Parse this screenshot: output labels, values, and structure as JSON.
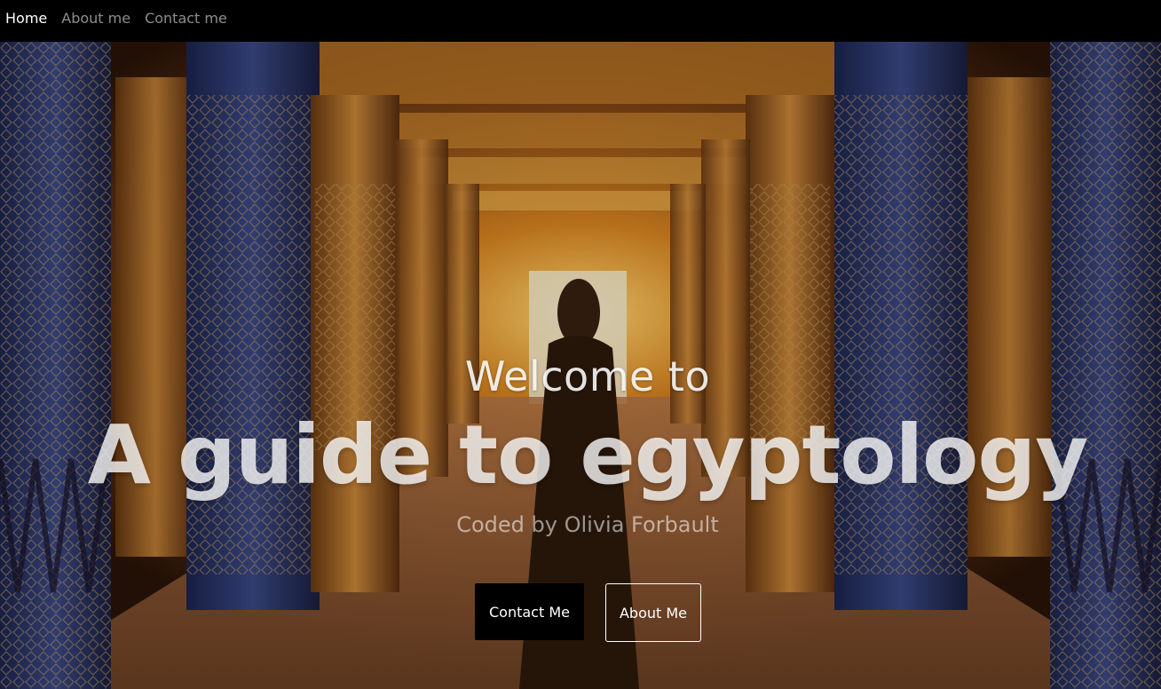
{
  "nav": {
    "items": [
      {
        "label": "Home",
        "active": true
      },
      {
        "label": "About me",
        "active": false
      },
      {
        "label": "Contact me",
        "active": false
      }
    ]
  },
  "hero": {
    "welcome": "Welcome to",
    "title": "A guide to egyptology",
    "subtitle": "Coded by Olivia Forbault",
    "buttons": {
      "contact": "Contact Me",
      "about": "About Me"
    }
  },
  "colors": {
    "navbar_bg": "#000000",
    "contact_button_bg": "#000000",
    "about_button_border": "#ffffff",
    "nav_active": "#ffffff"
  }
}
